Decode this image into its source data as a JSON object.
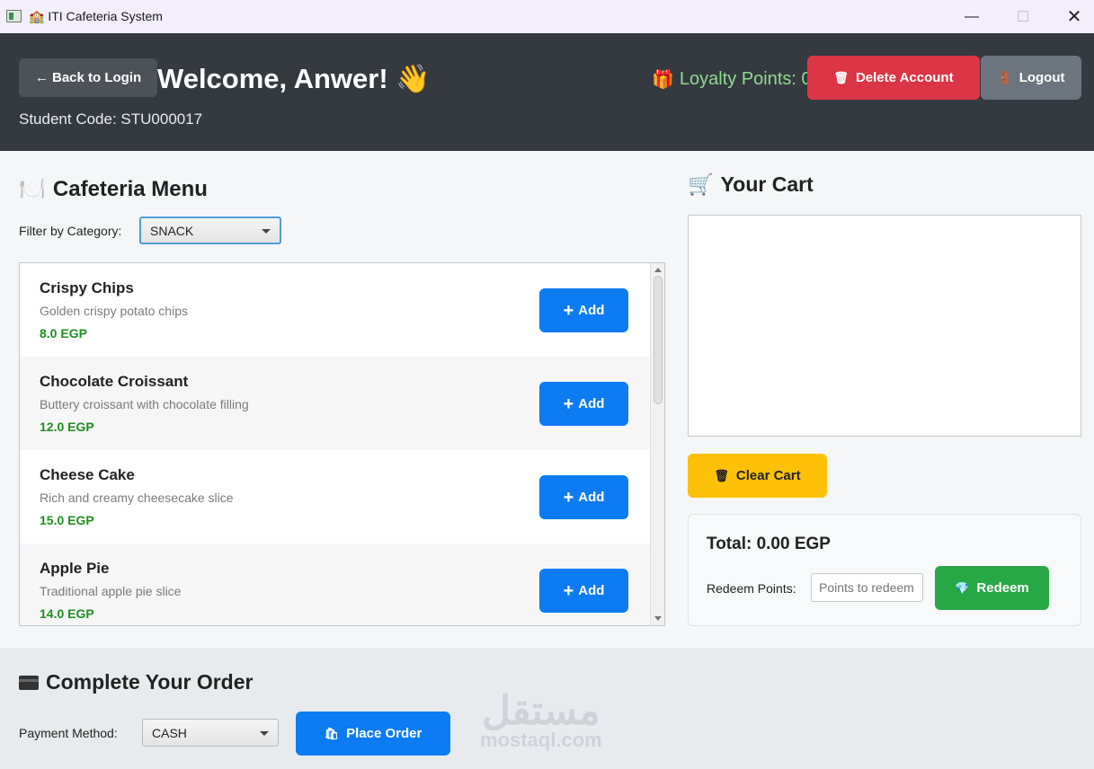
{
  "window": {
    "title": "ITI Cafeteria System",
    "title_icon": "🏫",
    "minimize": "—",
    "maximize": "☐",
    "close": "✕"
  },
  "header": {
    "back_button": "← Back to Login",
    "welcome": "Welcome, Anwer! 👋",
    "student_code": "Student Code: STU000017",
    "loyalty_icon": "🎁",
    "loyalty": "Loyalty Points: 0",
    "delete_icon": "🗑",
    "delete_button": "Delete Account",
    "logout_icon": "🚪",
    "logout_button": "Logout",
    "colors": {
      "header_bg": "#343a40",
      "delete": "#dc3545",
      "logout": "#6c757d",
      "loyalty": "#8fdc8f"
    }
  },
  "menu": {
    "title_icon": "🍽️",
    "title": "Cafeteria Menu",
    "filter_label": "Filter by Category:",
    "filter_value": "SNACK",
    "add_label": "Add",
    "add_icon": "+",
    "items": [
      {
        "name": "Crispy Chips",
        "desc": "Golden crispy potato chips",
        "price": "8.0 EGP"
      },
      {
        "name": "Chocolate Croissant",
        "desc": "Buttery croissant with chocolate filling",
        "price": "12.0 EGP"
      },
      {
        "name": "Cheese Cake",
        "desc": "Rich and creamy cheesecake slice",
        "price": "15.0 EGP"
      },
      {
        "name": "Apple Pie",
        "desc": "Traditional apple pie slice",
        "price": "14.0 EGP"
      }
    ],
    "colors": {
      "add": "#0d7bf2",
      "price": "#1f8f1f"
    }
  },
  "cart": {
    "title_icon": "🛒",
    "title": "Your Cart",
    "clear_icon": "🗑",
    "clear_button": "Clear Cart",
    "total": "Total: 0.00 EGP",
    "redeem_label": "Redeem Points:",
    "redeem_placeholder": "Points to redeem",
    "redeem_icon": "💎",
    "redeem_button": "Redeem",
    "colors": {
      "clear": "#ffc107",
      "redeem": "#28a745"
    }
  },
  "order": {
    "title": "Complete Your Order",
    "title_icon": "credit-card-icon",
    "payment_label": "Payment Method:",
    "payment_value": "CASH",
    "place_icon": "🛍",
    "place_button": "Place Order"
  },
  "watermark": {
    "arabic": "مستقل",
    "latin": "mostaql.com"
  }
}
